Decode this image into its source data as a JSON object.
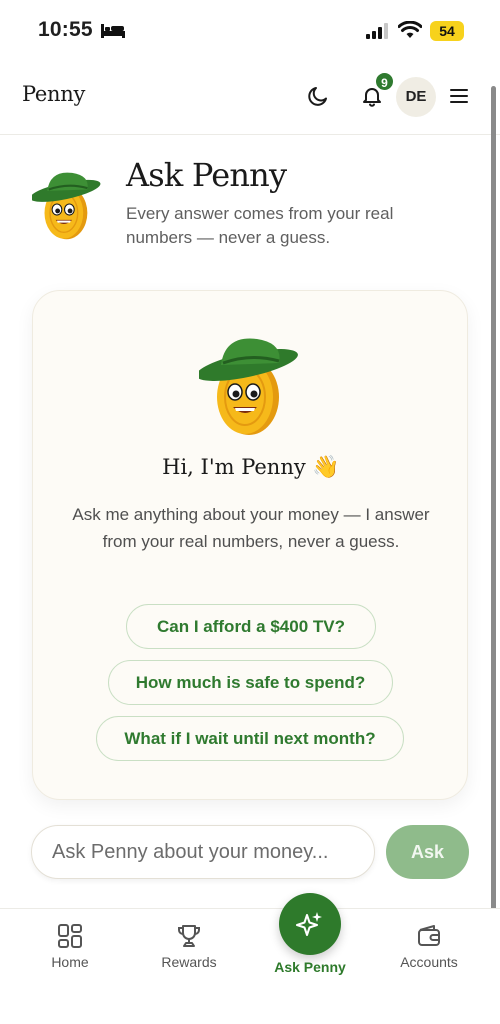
{
  "status_bar": {
    "time": "10:55",
    "battery": "54"
  },
  "app_bar": {
    "brand": "Penny",
    "notification_count": "9",
    "avatar_initials": "DE"
  },
  "header": {
    "title": "Ask Penny",
    "subtitle": "Every answer comes from your real numbers — never a guess."
  },
  "chat": {
    "greeting": "Hi, I'm Penny",
    "greeting_emoji": "👋",
    "intro": "Ask me anything about your money — I answer from your real numbers, never a guess.",
    "suggestions": [
      "Can I afford a $400 TV?",
      "How much is safe to spend?",
      "What if I wait until next month?"
    ]
  },
  "input": {
    "placeholder": "Ask Penny about your money...",
    "button_label": "Ask"
  },
  "nav": {
    "items": [
      {
        "label": "Home",
        "icon": "grid-icon"
      },
      {
        "label": "Rewards",
        "icon": "trophy-icon"
      },
      {
        "label": "Ask Penny",
        "icon": "sparkle-icon",
        "active": true
      },
      {
        "label": "Accounts",
        "icon": "wallet-icon"
      }
    ]
  },
  "colors": {
    "accent": "#2e7a2b",
    "ask_button": "#8fbb8b",
    "card_bg": "#fdfbf6",
    "chip_text": "#2f7a2f"
  }
}
